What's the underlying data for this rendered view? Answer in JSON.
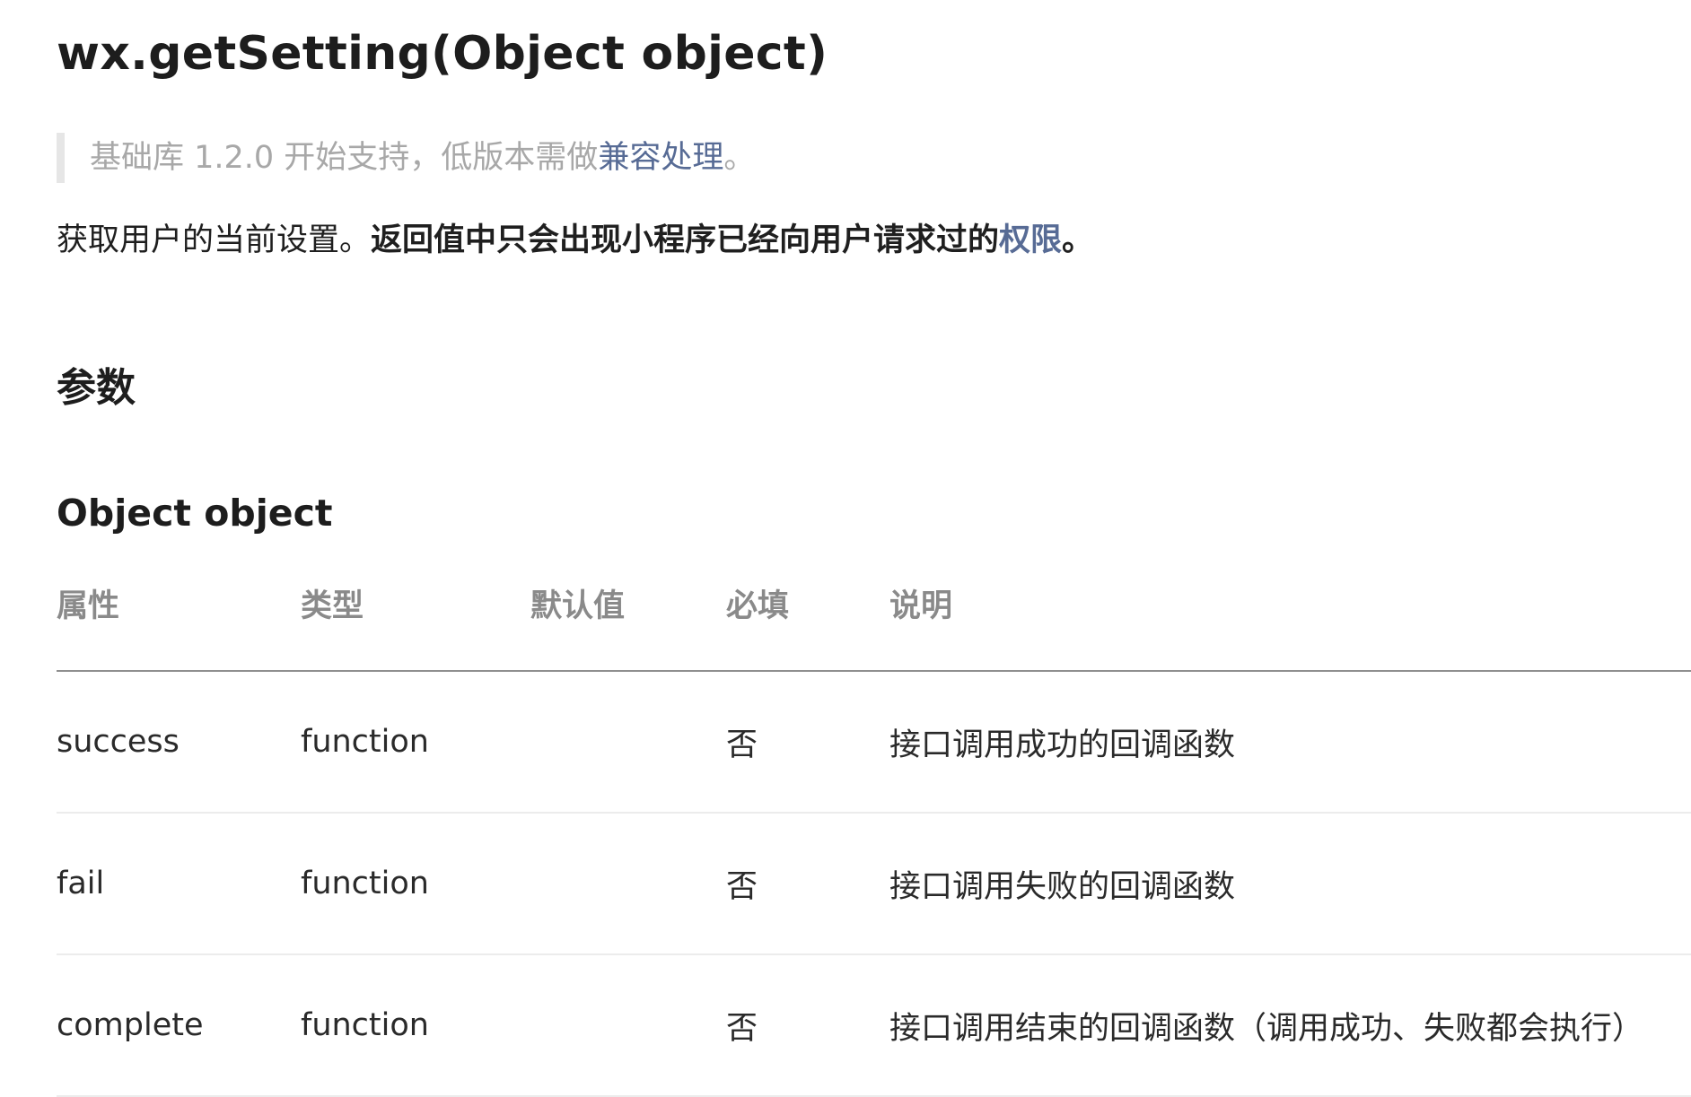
{
  "title": "wx.getSetting(Object object)",
  "support_note": {
    "prefix": "基础库 1.2.0 开始支持，低版本需做",
    "link_text": "兼容处理",
    "suffix": "。"
  },
  "description": {
    "plain": "获取用户的当前设置。",
    "bold": "返回值中只会出现小程序已经向用户请求过的",
    "link_text": "权限",
    "suffix": "。"
  },
  "section_heading": "参数",
  "object_heading": "Object object",
  "table": {
    "headers": [
      "属性",
      "类型",
      "默认值",
      "必填",
      "说明"
    ],
    "rows": [
      {
        "name": "success",
        "type": "function",
        "default": "",
        "required": "否",
        "desc": "接口调用成功的回调函数"
      },
      {
        "name": "fail",
        "type": "function",
        "default": "",
        "required": "否",
        "desc": "接口调用失败的回调函数"
      },
      {
        "name": "complete",
        "type": "function",
        "default": "",
        "required": "否",
        "desc": "接口调用结束的回调函数（调用成功、失败都会执行）"
      }
    ]
  },
  "colors": {
    "link": "#576b95",
    "muted_text": "#a8a8a8",
    "header_text": "#8a8a8a",
    "quote_bar": "#e6e6e6"
  }
}
